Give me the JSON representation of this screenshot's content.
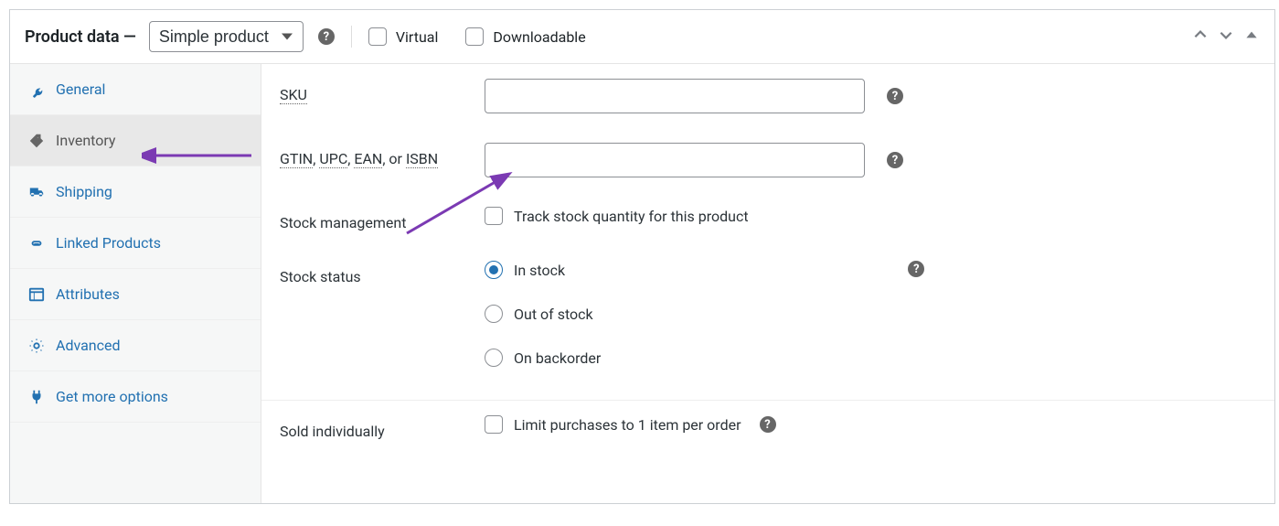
{
  "header": {
    "title": "Product data —",
    "productType": "Simple product",
    "virtual": "Virtual",
    "downloadable": "Downloadable"
  },
  "tabs": [
    {
      "id": "general",
      "label": "General",
      "icon": "wrench",
      "active": false
    },
    {
      "id": "inventory",
      "label": "Inventory",
      "icon": "tag",
      "active": true
    },
    {
      "id": "shipping",
      "label": "Shipping",
      "icon": "truck",
      "active": false
    },
    {
      "id": "linked",
      "label": "Linked Products",
      "icon": "link",
      "active": false
    },
    {
      "id": "attributes",
      "label": "Attributes",
      "icon": "list",
      "active": false
    },
    {
      "id": "advanced",
      "label": "Advanced",
      "icon": "gear",
      "active": false
    },
    {
      "id": "more",
      "label": "Get more options",
      "icon": "plug",
      "active": false
    }
  ],
  "fields": {
    "sku_label": "SKU",
    "sku_value": "",
    "code_parts": [
      "GTIN",
      ", ",
      "UPC",
      ", ",
      "EAN",
      ", or ",
      "ISBN"
    ],
    "code_value": "",
    "stock_mgmt_label": "Stock management",
    "stock_mgmt_check": "Track stock quantity for this product",
    "stock_status_label": "Stock status",
    "stock_options": [
      {
        "label": "In stock",
        "checked": true
      },
      {
        "label": "Out of stock",
        "checked": false
      },
      {
        "label": "On backorder",
        "checked": false
      }
    ],
    "sold_ind_label": "Sold individually",
    "sold_ind_check": "Limit purchases to 1 item per order"
  },
  "colors": {
    "accent": "#2271b1",
    "annotation": "#7b3ab3"
  }
}
